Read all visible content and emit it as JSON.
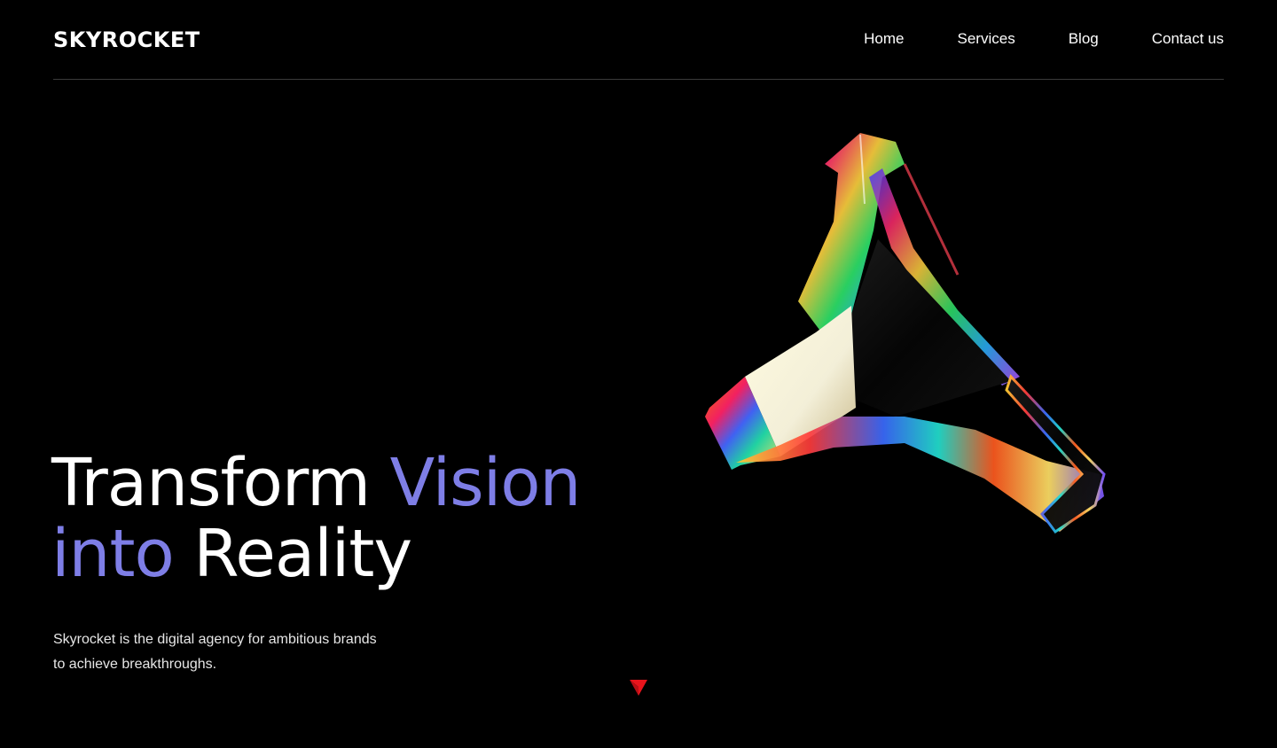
{
  "brand": {
    "logo_text": "SKYROCKET"
  },
  "nav": {
    "items": [
      {
        "label": "Home"
      },
      {
        "label": "Services"
      },
      {
        "label": "Blog"
      },
      {
        "label": "Contact us"
      }
    ]
  },
  "hero": {
    "title_part1": "Transform ",
    "title_part2": "Vision",
    "title_part3": "into",
    "title_part4": " Reality",
    "subtitle": "Skyrocket is the digital agency for ambitious brands to achieve breakthroughs."
  },
  "colors": {
    "background": "#000000",
    "text": "#ffffff",
    "accent": "#7e7ee6",
    "divider": "#3a3a3a",
    "cursor": "#e8141c"
  },
  "icons": {
    "hero_graphic": "iridescent-triangle-prism",
    "scroll_cursor": "pointer-arrow-icon"
  }
}
